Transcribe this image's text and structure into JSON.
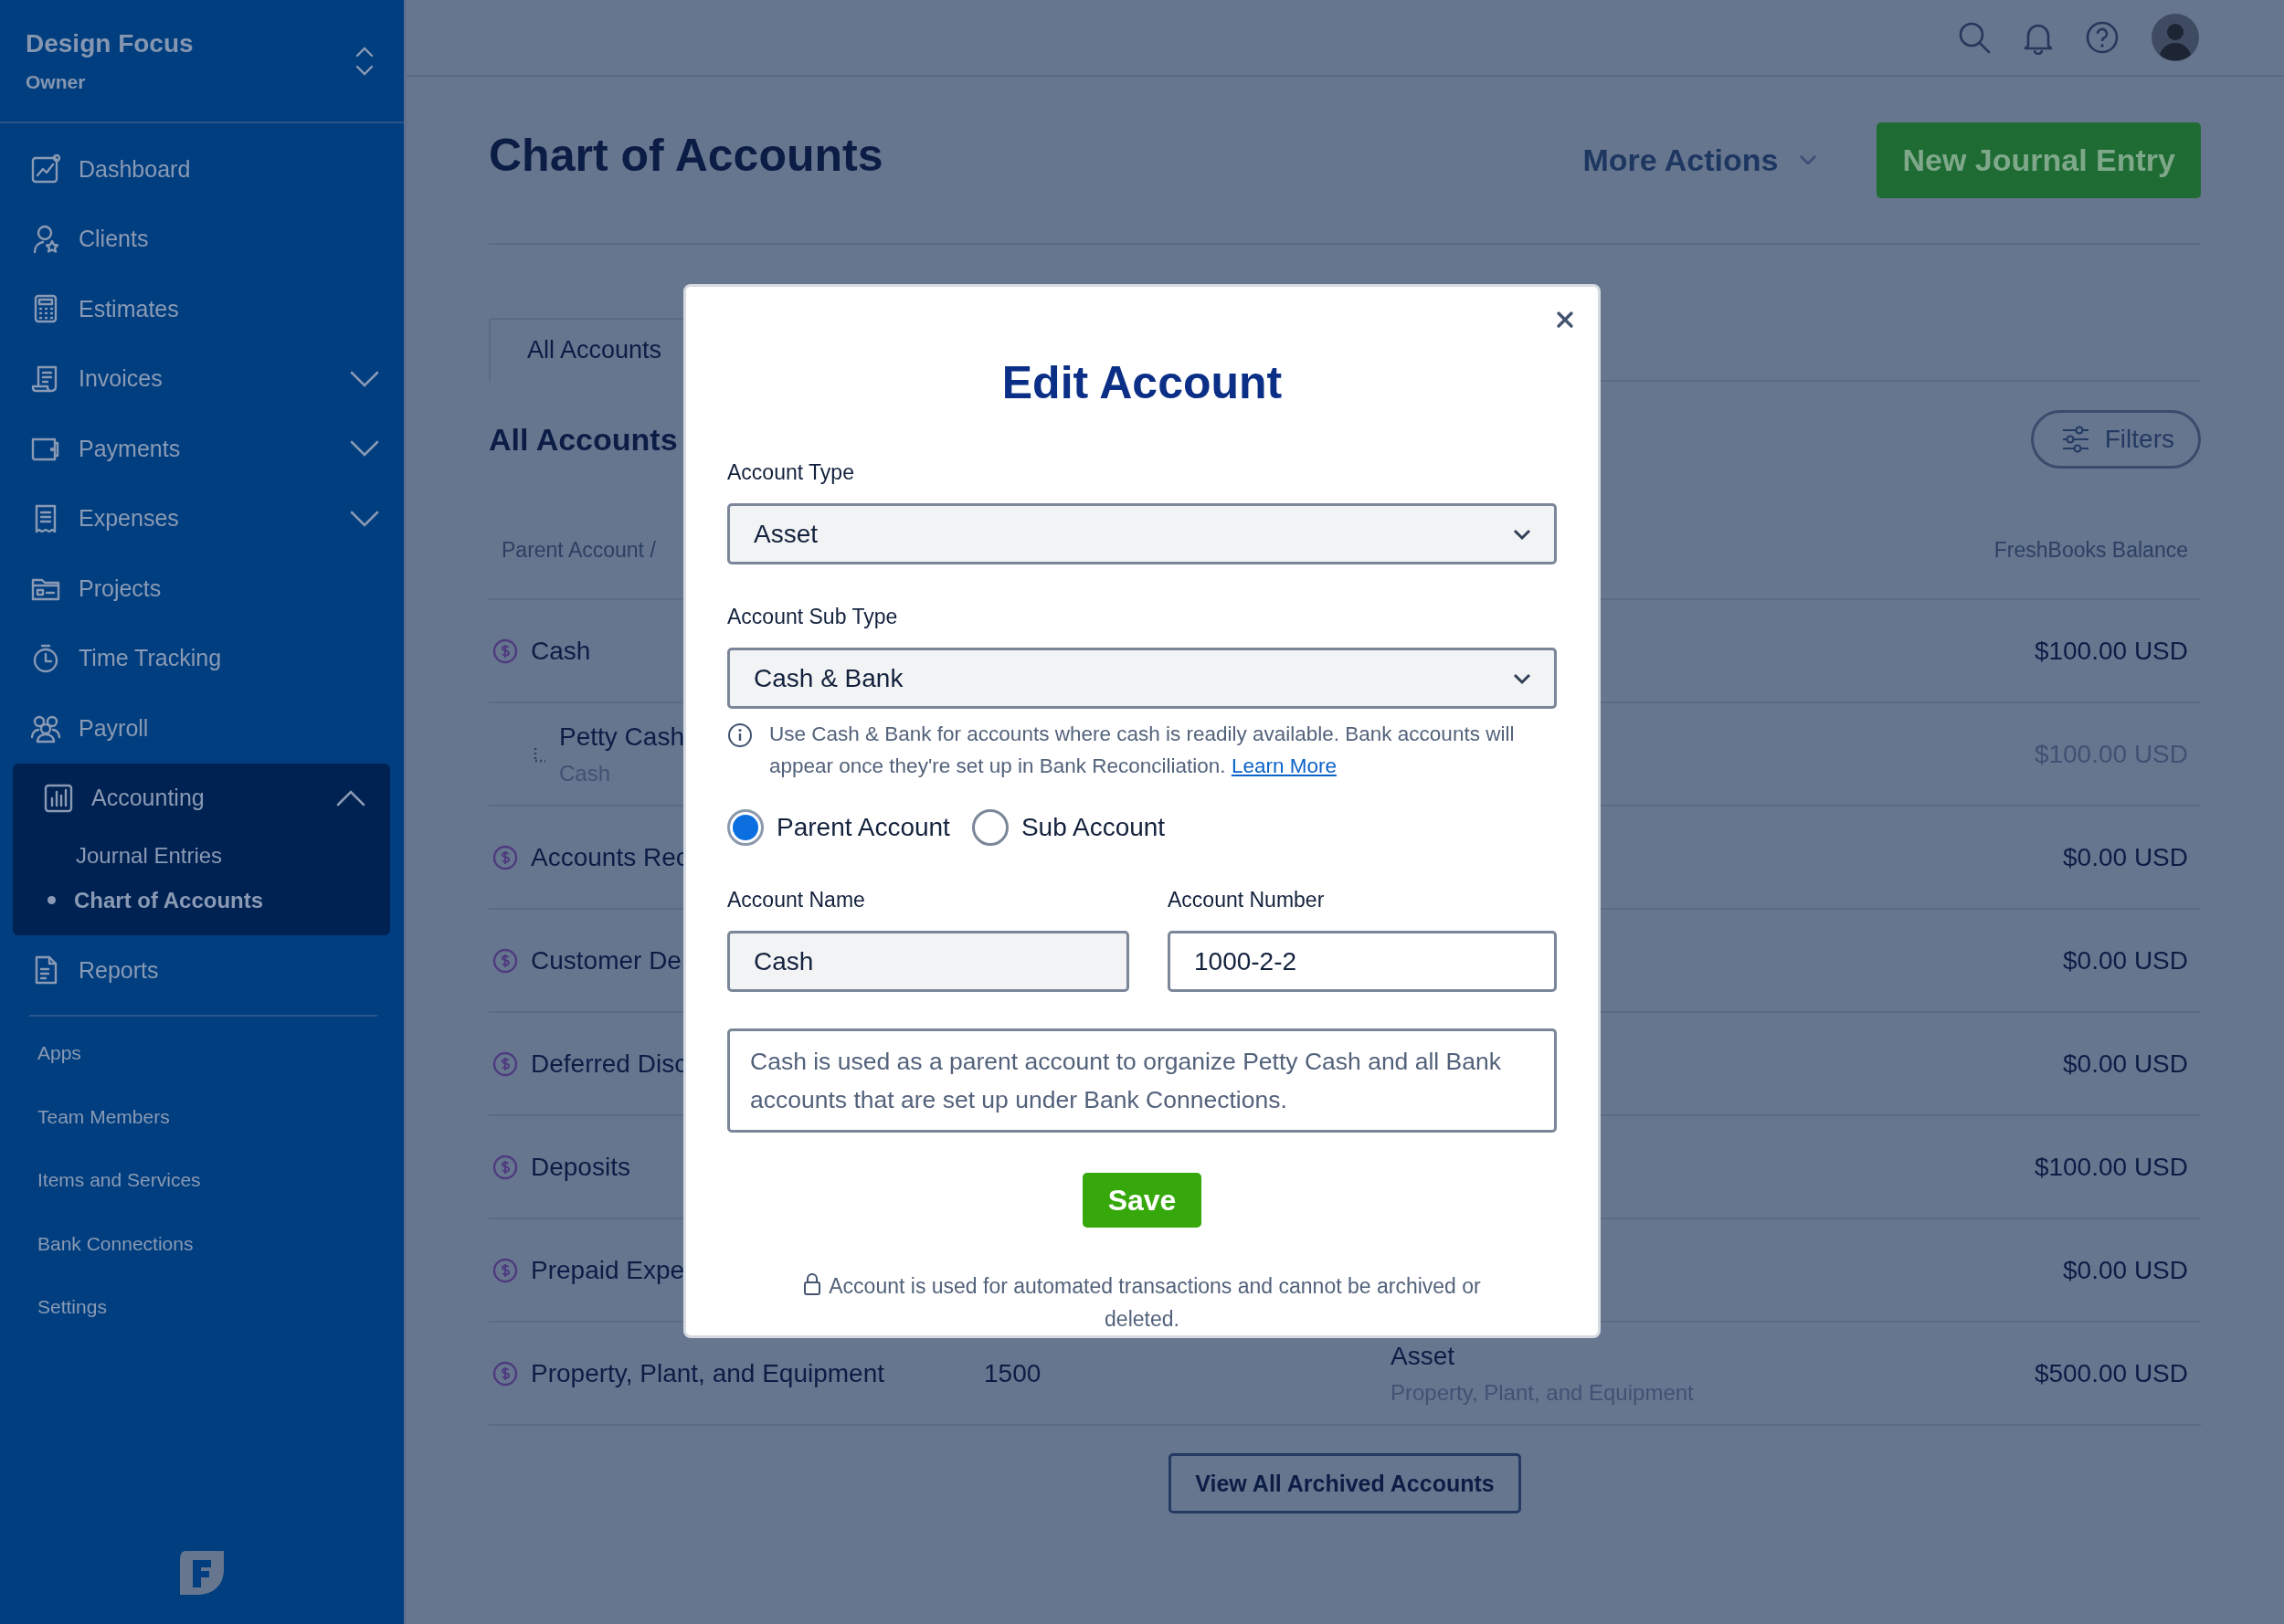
{
  "sidebar": {
    "business": "Design Focus",
    "role": "Owner",
    "items": [
      {
        "label": "Dashboard",
        "selected": false
      },
      {
        "label": "Clients",
        "selected": false
      },
      {
        "label": "Estimates",
        "selected": false
      },
      {
        "label": "Invoices",
        "selected": false,
        "expanded": false
      },
      {
        "label": "Payments",
        "selected": false,
        "expanded": false
      },
      {
        "label": "Expenses",
        "selected": false,
        "expanded": false
      },
      {
        "label": "Projects",
        "selected": false
      },
      {
        "label": "Time Tracking",
        "selected": false
      },
      {
        "label": "Payroll",
        "selected": false
      },
      {
        "label": "Accounting",
        "selected": true,
        "expanded": true,
        "children": [
          {
            "label": "Journal Entries",
            "selected": false
          },
          {
            "label": "Chart of Accounts",
            "selected": true
          }
        ]
      },
      {
        "label": "Reports",
        "selected": false
      }
    ],
    "secondary_items": [
      "Apps",
      "Team Members",
      "Items and Services",
      "Bank Connections",
      "Settings"
    ]
  },
  "page": {
    "title": "Chart of Accounts",
    "more_actions": "More Actions",
    "primary_button": "New Journal Entry",
    "tabs": [
      {
        "label": "All Accounts",
        "selected": true
      }
    ],
    "section_title": "All Accounts",
    "filters_button": "Filters",
    "table": {
      "columns": [
        "Parent Account /",
        "FreshBooks Balance"
      ],
      "rows": [
        {
          "name": "Cash",
          "balance": "$100.00 USD",
          "children": [
            {
              "name": "Petty Cash",
              "parent": "Cash",
              "balance": "$100.00 USD"
            }
          ]
        },
        {
          "name": "Accounts Rec",
          "balance": "$0.00 USD"
        },
        {
          "name": "Customer De",
          "balance": "$0.00 USD"
        },
        {
          "name": "Deferred Disc",
          "balance": "$0.00 USD"
        },
        {
          "name": "Deposits",
          "balance": "$100.00 USD"
        },
        {
          "name": "Prepaid Expe",
          "balance": "$0.00 USD"
        },
        {
          "name": "Property, Plant, and Equipment",
          "number": "1500",
          "type": "Asset",
          "subtype": "Property, Plant, and Equipment",
          "balance": "$500.00 USD"
        }
      ]
    },
    "archived_button": "View All Archived Accounts"
  },
  "modal": {
    "title": "Edit Account",
    "account_type": {
      "label": "Account Type",
      "value": "Asset"
    },
    "sub_type": {
      "label": "Account Sub Type",
      "value": "Cash & Bank"
    },
    "hint": "Use Cash & Bank for accounts where cash is readily available. Bank accounts will appear once they're set up in Bank Reconciliation.",
    "hint_link": "Learn More",
    "radios": [
      {
        "label": "Parent Account",
        "selected": true
      },
      {
        "label": "Sub Account",
        "selected": false
      }
    ],
    "account_name": {
      "label": "Account Name",
      "value": "Cash",
      "disabled": true
    },
    "account_number": {
      "label": "Account Number",
      "value": "1000-2-2",
      "disabled": false
    },
    "description": "Cash is used as a parent account to organize Petty Cash and all Bank accounts that are set up under Bank Connections.",
    "save_button": "Save",
    "note": "Account is used for automated transactions and cannot be archived or deleted."
  }
}
